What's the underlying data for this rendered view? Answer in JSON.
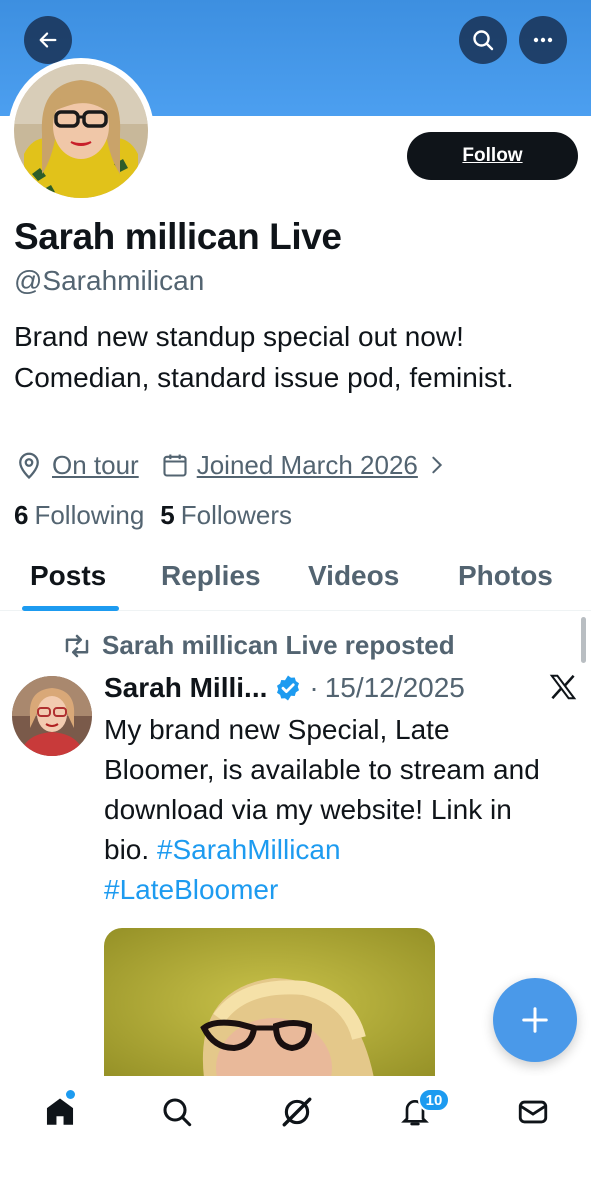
{
  "header": {
    "back_icon": "arrow-left-icon",
    "search_icon": "search-icon",
    "more_icon": "more-horizontal-icon"
  },
  "profile": {
    "follow_label": "Follow",
    "display_name": "Sarah millican Live",
    "handle": "@Sarahmilican",
    "bio": "Brand new standup special out now! Comedian, standard issue pod, feminist.",
    "location": "On tour",
    "joined": "Joined March 2026",
    "following_count": "6",
    "following_label": "Following",
    "followers_count": "5",
    "followers_label": "Followers"
  },
  "tabs": [
    {
      "label": "Posts",
      "active": true
    },
    {
      "label": "Replies",
      "active": false
    },
    {
      "label": "Videos",
      "active": false
    },
    {
      "label": "Photos",
      "active": false
    }
  ],
  "post": {
    "repost_text": "Sarah millican Live reposted",
    "author_name": "Sarah Milli...",
    "date_sep": "·",
    "date": "15/12/2025",
    "text_main": "My brand new Special, Late Bloomer, is available to stream and download via my website! Link in bio. ",
    "hashtag1": "#SarahMillican",
    "hashtag2": "#LateBloomer",
    "platform_icon": "x-logo-icon"
  },
  "nav": {
    "items": [
      "home-icon",
      "search-icon",
      "grok-icon",
      "bell-icon",
      "mail-icon"
    ],
    "notification_badge": "10"
  },
  "colors": {
    "banner": "#4c9ff0",
    "accent": "#1d9bf0",
    "fab": "#4a99e9",
    "text_secondary": "#536471"
  }
}
